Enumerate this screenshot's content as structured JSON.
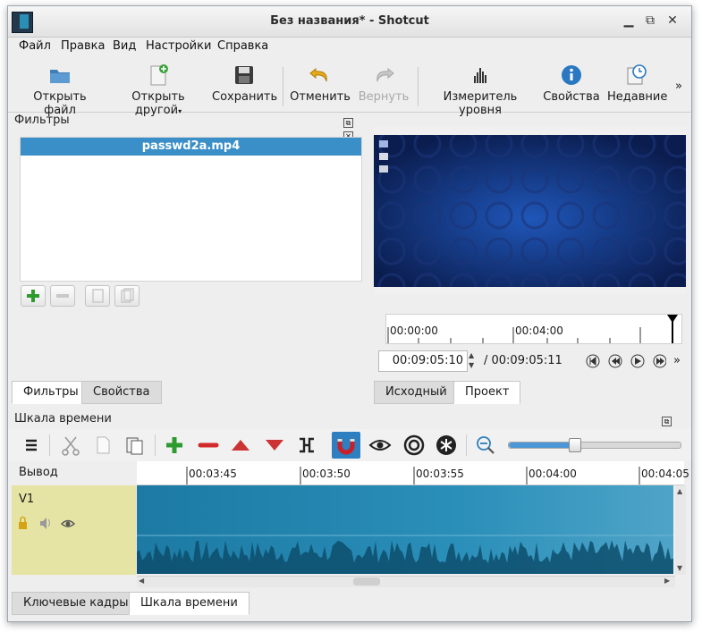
{
  "window": {
    "title": "Без названия* - Shotcut"
  },
  "menu": [
    "Файл",
    "Правка",
    "Вид",
    "Настройки",
    "Справка"
  ],
  "toolbar": {
    "open_file": "Открыть файл",
    "open_other": "Открыть другой",
    "save": "Сохранить",
    "undo": "Отменить",
    "redo": "Вернуть",
    "meter": "Измеритель уровня",
    "properties": "Свойства",
    "recent": "Недавние",
    "more": "»"
  },
  "filters_panel": {
    "title": "Фильтры",
    "clip_name": "passwd2a.mp4",
    "tab_filters": "Фильтры",
    "tab_properties": "Свойства"
  },
  "player": {
    "ruler_start": "00:00:00",
    "ruler_mid": "00:04:00",
    "position": "00:09:05:10",
    "duration": "/ 00:09:05:11",
    "tab_source": "Исходный",
    "tab_project": "Проект",
    "more": "»"
  },
  "timeline": {
    "title": "Шкала времени",
    "output_label": "Вывод",
    "track_v1": "V1",
    "ruler_labels": [
      "00:03:45",
      "00:03:50",
      "00:03:55",
      "00:04:00",
      "00:04:05"
    ],
    "zoom_level": 0.38
  },
  "bottom_tabs": {
    "keyframes": "Ключевые кадры",
    "timeline": "Шкала времени"
  },
  "colors": {
    "accent": "#3a8fc8",
    "clip": "#2a8fb9",
    "track_head": "#e6e4a4",
    "snap_active": "#2d7fc0"
  }
}
